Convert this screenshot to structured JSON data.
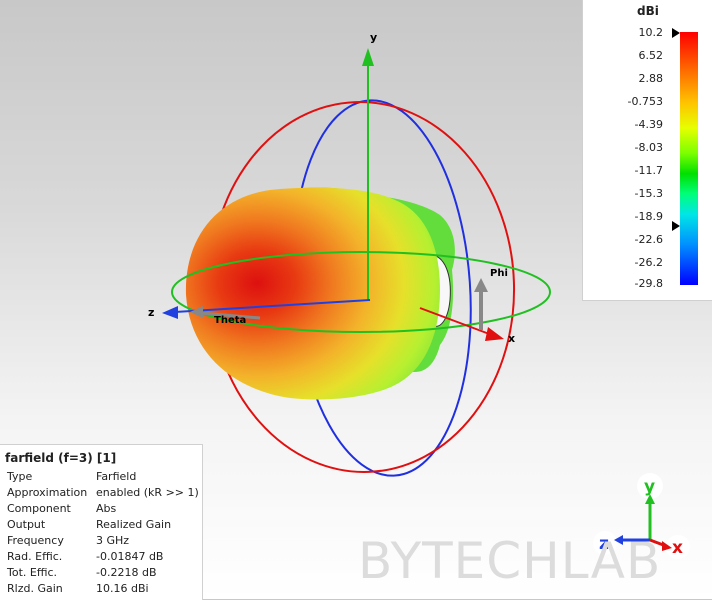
{
  "viewport": {
    "axes": {
      "x": "x",
      "y": "y",
      "z": "z"
    },
    "angle_labels": {
      "theta": "Theta",
      "phi": "Phi"
    }
  },
  "colorbar": {
    "unit": "dBi",
    "ticks": [
      "10.2",
      "6.52",
      "2.88",
      "-0.753",
      "-4.39",
      "-8.03",
      "-11.7",
      "-15.3",
      "-18.9",
      "-22.6",
      "-26.2",
      "-29.8"
    ]
  },
  "info": {
    "title": "farfield (f=3) [1]",
    "rows": [
      {
        "key": "Type",
        "value": "Farfield"
      },
      {
        "key": "Approximation",
        "value": "enabled (kR >> 1)"
      },
      {
        "key": "Component",
        "value": "Abs"
      },
      {
        "key": "Output",
        "value": "Realized Gain"
      },
      {
        "key": "Frequency",
        "value": "3 GHz"
      },
      {
        "key": "Rad. Effic.",
        "value": "-0.01847 dB"
      },
      {
        "key": "Tot. Effic.",
        "value": "-0.2218 dB"
      },
      {
        "key": "Rlzd. Gain",
        "value": "10.16 dBi"
      }
    ]
  },
  "orientation": {
    "y": "y",
    "z": "z",
    "x": "x"
  },
  "watermark": "BYTECHLAB",
  "colors": {
    "x_axis": "#e01010",
    "y_axis": "#10c010",
    "z_axis": "#2040e0"
  }
}
